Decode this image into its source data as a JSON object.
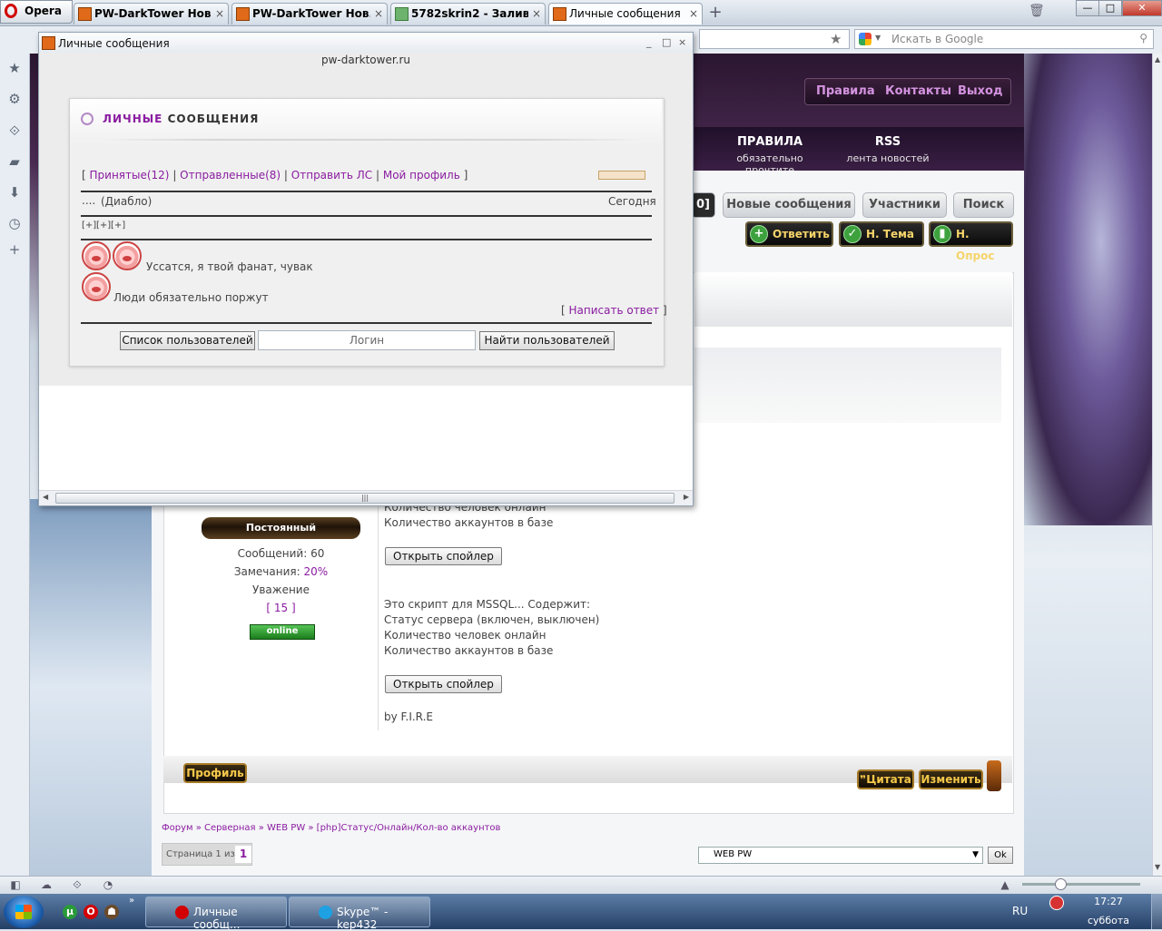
{
  "browser": {
    "menu_label": "Opera",
    "tabs": [
      {
        "label": "PW-DarkTower Нов...",
        "close": "×"
      },
      {
        "label": "PW-DarkTower Нов...",
        "close": "×"
      },
      {
        "label": "5782skrin2 - Залив...",
        "close": "×"
      },
      {
        "label": "Личные сообщения",
        "close": "×"
      }
    ],
    "new_tab": "+",
    "window_controls": {
      "minimize": "—",
      "maximize": "□",
      "close": "✕"
    },
    "search_placeholder": "Искать в Google",
    "search_google_word": "Google"
  },
  "site": {
    "top_nav": [
      "Правила",
      "Контакты",
      "Выход"
    ],
    "site_nav": [
      {
        "title": "ПРАВИЛА",
        "sub": "обязательно прочтите"
      },
      {
        "title": "RSS",
        "sub": "лента новостей"
      }
    ],
    "forum_tabs": [
      "0]",
      "Новые сообщения",
      "Участники",
      "Поиск"
    ],
    "actions": [
      "Ответить",
      "Н. Тема",
      "Н. Опрос"
    ],
    "user": {
      "rank": "Постоянный",
      "messages": "Сообщений: 60",
      "warnings_label": "Замечания: ",
      "warnings_value": "20%",
      "respect_label": "Уважение",
      "respect_value": "[ 15 ]",
      "status": "online"
    },
    "post": {
      "top_lines": [
        "Количество человек онлайн",
        "Количество аккаунтов в базе"
      ],
      "spoiler_label": "Открыть спойлер",
      "body_lines": [
        "Это скрипт для MSSQL... Содержит:",
        "Статус сервера (включен, выключен)",
        "Количество человек онлайн",
        "Количество аккаунтов в базе"
      ],
      "signature": "by F.I.R.E"
    },
    "post_buttons": {
      "profile": "Профиль",
      "quote": "Цитата",
      "edit": "Изменить"
    },
    "breadcrumb": "Форум » Серверная » WEB PW » [php]Статус/Онлайн/Кол-во аккаунтов",
    "pager": {
      "label": "Страница 1 из 1",
      "current": "1"
    },
    "jump": {
      "selected": "WEB PW",
      "ok": "Ok"
    }
  },
  "popup": {
    "title": "Личные сообщения",
    "controls": {
      "minimize": "_",
      "maximize": "□",
      "close": "×"
    },
    "url": "pw-darktower.ru",
    "header_accent": "ЛИЧНЫЕ",
    "header_rest": " СООБЩЕНИЯ",
    "nav": {
      "open": "[ ",
      "inbox": "Принятые",
      "inbox_count": "(12)",
      "sep1": " | ",
      "sent": "Отправленные",
      "sent_count": "(8)",
      "sep2": " | ",
      "send": "Отправить ЛС",
      "sep3": " | ",
      "profile": "Мой профиль",
      "close": " ]"
    },
    "message": {
      "prefix": "....",
      "from": "(Диабло)",
      "date": "Сегодня"
    },
    "expanders": [
      "[+]",
      "[+]",
      "[+]"
    ],
    "lines": [
      "Уссатся, я твой фанат, чувак",
      "Люди обязательно поржут"
    ],
    "reply": {
      "open": "[ ",
      "label": "Написать ответ",
      "close": " ]"
    },
    "form": {
      "user_list": "Список пользователей",
      "login_placeholder": "Логин",
      "find": "Найти пользователей"
    }
  },
  "taskbar": {
    "items": [
      "Личные сообщ...",
      "Skype™ - kep432"
    ],
    "lang": "RU",
    "time": "17:27",
    "day": "суббота"
  },
  "colors": {
    "accent_purple": "#8a1ca0",
    "gold": "#f5c84a",
    "online_green": "#2e9e2e"
  }
}
